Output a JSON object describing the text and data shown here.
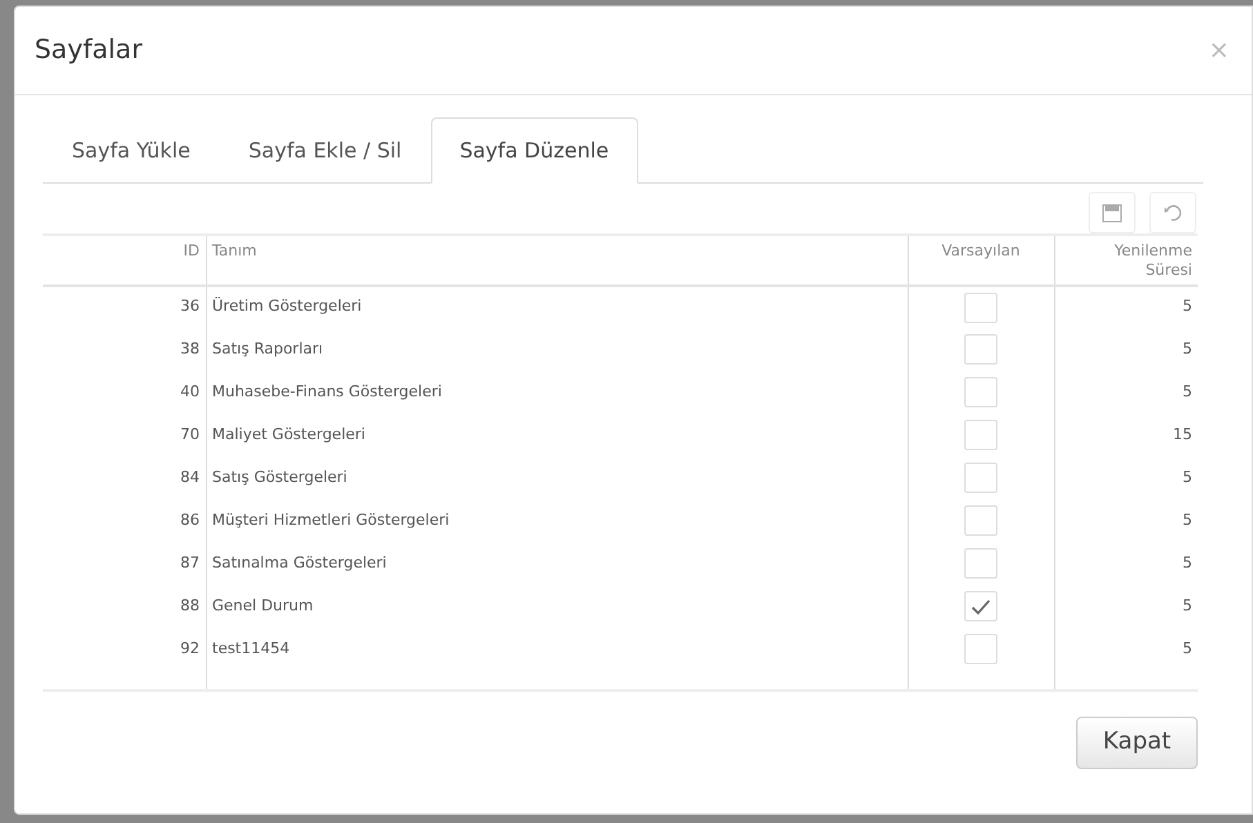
{
  "dialog": {
    "title": "Sayfalar",
    "close": "×"
  },
  "tabs": [
    {
      "label": "Sayfa Yükle",
      "selected": false
    },
    {
      "label": "Sayfa Ekle / Sil",
      "selected": false
    },
    {
      "label": "Sayfa Düzenle",
      "selected": true
    }
  ],
  "table": {
    "columns": [
      "ID",
      "Tanım",
      "Varsayılan",
      "Yenilenme Süresi"
    ],
    "rows": [
      {
        "id": "36",
        "name": "Üretim Göstergeleri",
        "default": false,
        "refresh": "5"
      },
      {
        "id": "38",
        "name": "Satış Raporları",
        "default": false,
        "refresh": "5"
      },
      {
        "id": "40",
        "name": "Muhasebe-Finans Göstergeleri",
        "default": false,
        "refresh": "5"
      },
      {
        "id": "70",
        "name": "Maliyet Göstergeleri",
        "default": false,
        "refresh": "15"
      },
      {
        "id": "84",
        "name": "Satış Göstergeleri",
        "default": false,
        "refresh": "5"
      },
      {
        "id": "86",
        "name": "Müşteri Hizmetleri Göstergeleri",
        "default": false,
        "refresh": "5"
      },
      {
        "id": "87",
        "name": "Satınalma Göstergeleri",
        "default": false,
        "refresh": "5"
      },
      {
        "id": "88",
        "name": "Genel Durum",
        "default": true,
        "refresh": "5"
      },
      {
        "id": "92",
        "name": "test11454",
        "default": false,
        "refresh": "5"
      }
    ]
  },
  "buttons": [
    "Kapat"
  ]
}
